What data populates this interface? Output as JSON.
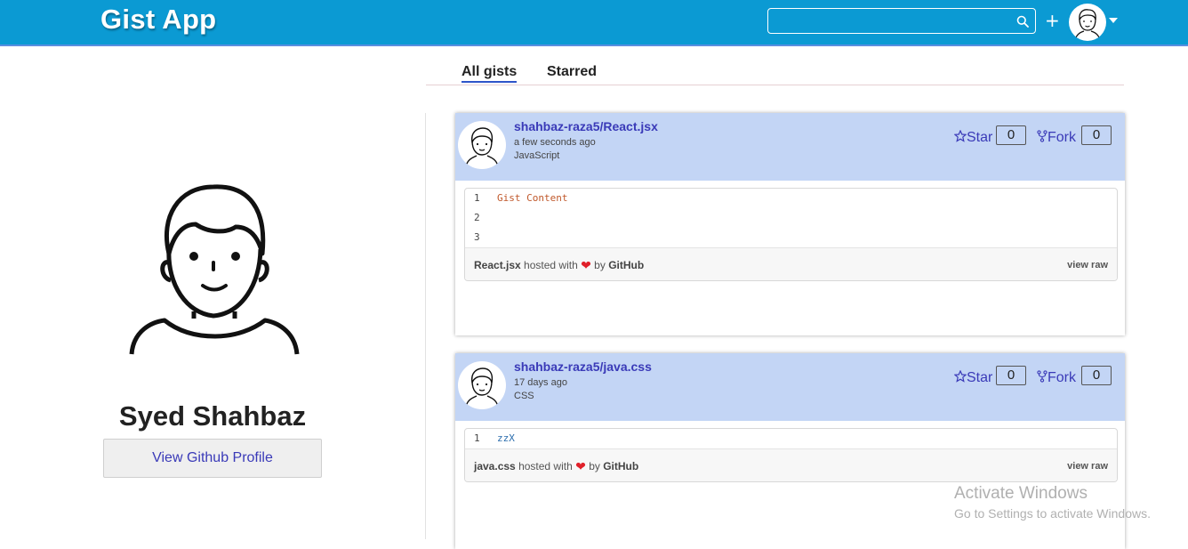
{
  "app": {
    "title": "Gist App"
  },
  "header": {
    "search_value": "",
    "search_icon": "search-icon",
    "new_gist_label": "+",
    "avatar_icon": "user-avatar-icon",
    "menu_icon": "caret-down-icon"
  },
  "profile": {
    "name": "Syed Shahbaz",
    "github_button": "View Github Profile"
  },
  "tabs": [
    {
      "label": "All gists",
      "active": true
    },
    {
      "label": "Starred",
      "active": false
    }
  ],
  "gists": [
    {
      "title": "shahbaz-raza5/React.jsx",
      "time": "a few seconds ago",
      "language": "JavaScript",
      "star_label": "Star",
      "star_count": "0",
      "fork_label": "Fork",
      "fork_count": "0",
      "lines": [
        {
          "no": "1",
          "code": "Gist Content"
        },
        {
          "no": "2",
          "code": ""
        },
        {
          "no": "3",
          "code": ""
        }
      ],
      "file_name": "React.jsx",
      "hosted_text": "hosted with",
      "by_text": "by",
      "host": "GitHub",
      "raw_label": "view raw"
    },
    {
      "title": "shahbaz-raza5/java.css",
      "time": "17 days ago",
      "language": "CSS",
      "star_label": "Star",
      "star_count": "0",
      "fork_label": "Fork",
      "fork_count": "0",
      "lines": [
        {
          "no": "1",
          "code": "zzX"
        }
      ],
      "file_name": "java.css",
      "hosted_text": "hosted with",
      "by_text": "by",
      "host": "GitHub",
      "raw_label": "view raw"
    }
  ],
  "watermark": {
    "line1": "Activate Windows",
    "line2": "Go to Settings to activate Windows."
  },
  "colors": {
    "header": "#0b9ad3",
    "card_header": "#c3d5f5",
    "link": "#3a3ab8",
    "heart": "#e0202a"
  }
}
